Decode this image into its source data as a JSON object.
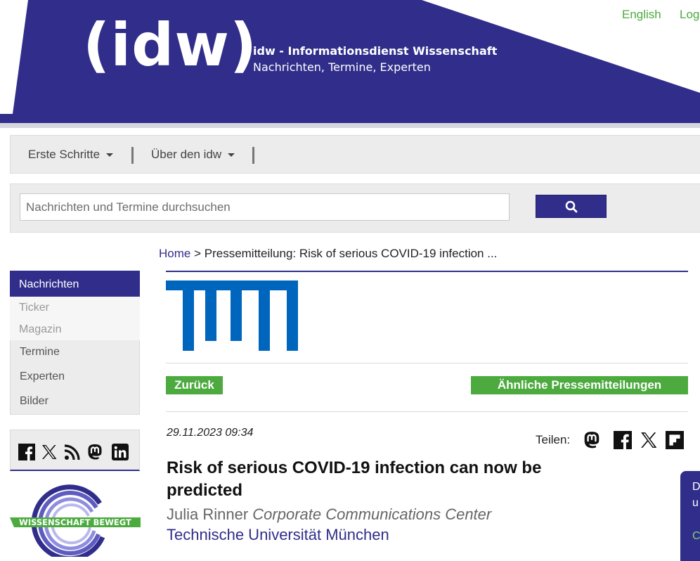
{
  "header": {
    "logo": "(idw)",
    "title": "idw - Informationsdienst Wissenschaft",
    "subtitle": "Nachrichten, Termine, Experten",
    "links": [
      "English",
      "Log"
    ]
  },
  "nav": {
    "items": [
      "Erste Schritte",
      "Über den idw"
    ]
  },
  "search": {
    "placeholder": "Nachrichten und Termine durchsuchen",
    "icon": "search-icon"
  },
  "breadcrumb": {
    "home": "Home",
    "separator": " > ",
    "current": "Pressemitteilung: Risk of serious COVID-19 infection ..."
  },
  "sidebar": {
    "header": "Nachrichten",
    "sub_items": [
      "Ticker",
      "Magazin"
    ],
    "items": [
      "Termine",
      "Experten",
      "Bilder"
    ],
    "social_icons": [
      "facebook-icon",
      "x-icon",
      "rss-icon",
      "mastodon-icon",
      "linkedin-icon"
    ],
    "badge": "WISSENSCHAFT BEWEGT"
  },
  "article": {
    "back_label": "Zurück",
    "similar_label": "Ähnliche Pressemitteilungen",
    "date": "29.11.2023 09:34",
    "share_label": "Teilen:",
    "share_icons": [
      "mastodon-icon",
      "facebook-icon",
      "x-icon",
      "flipboard-icon"
    ],
    "headline": "Risk of serious COVID-19 infection can now be predicted",
    "author_name": "Julia Rinner",
    "author_role": "Corporate Communications Center",
    "institution": "Technische Universität München"
  },
  "cookie_panel": {
    "lines": [
      "D",
      "u",
      "C"
    ]
  },
  "colors": {
    "brand": "#302e8a",
    "accent_green": "#4caa3f",
    "tum_blue": "#0065bd"
  }
}
